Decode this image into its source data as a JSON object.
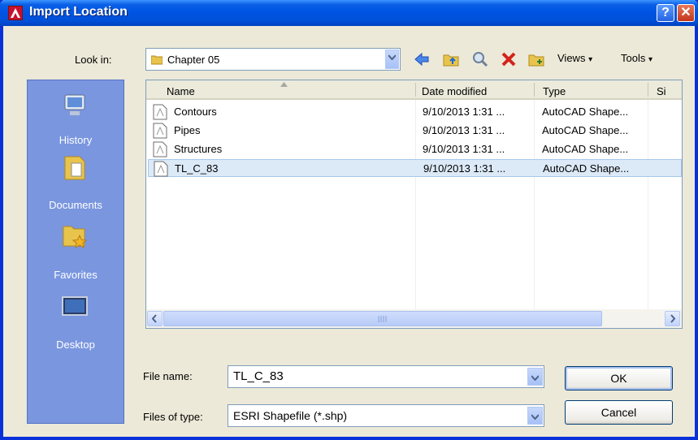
{
  "window": {
    "title": "Import Location"
  },
  "titlebar": {
    "help_glyph": "?",
    "close_glyph": "✕"
  },
  "lookin": {
    "label": "Look in:",
    "value": "Chapter 05"
  },
  "toolbar": {
    "views_label": "Views",
    "tools_label": "Tools"
  },
  "places": [
    {
      "label": "History",
      "icon": "history-icon"
    },
    {
      "label": "Documents",
      "icon": "documents-icon"
    },
    {
      "label": "Favorites",
      "icon": "favorites-icon"
    },
    {
      "label": "Desktop",
      "icon": "desktop-icon"
    }
  ],
  "columns": {
    "name": "Name",
    "date": "Date modified",
    "type": "Type",
    "size": "Si"
  },
  "files": [
    {
      "name": "Contours",
      "date": "9/10/2013 1:31 ...",
      "type": "AutoCAD Shape..."
    },
    {
      "name": "Pipes",
      "date": "9/10/2013 1:31 ...",
      "type": "AutoCAD Shape..."
    },
    {
      "name": "Structures",
      "date": "9/10/2013 1:31 ...",
      "type": "AutoCAD Shape..."
    },
    {
      "name": "TL_C_83",
      "date": "9/10/2013 1:31 ...",
      "type": "AutoCAD Shape..."
    }
  ],
  "selected_file": "TL_C_83",
  "filename": {
    "label": "File name:",
    "value": "TL_C_83"
  },
  "filetype": {
    "label": "Files of type:",
    "value": "ESRI Shapefile  (*.shp)"
  },
  "buttons": {
    "ok": "OK",
    "cancel": "Cancel"
  },
  "colors": {
    "titlebar": "#0054e3",
    "places_panel": "#7a96df",
    "selection": "#dce9f7"
  }
}
